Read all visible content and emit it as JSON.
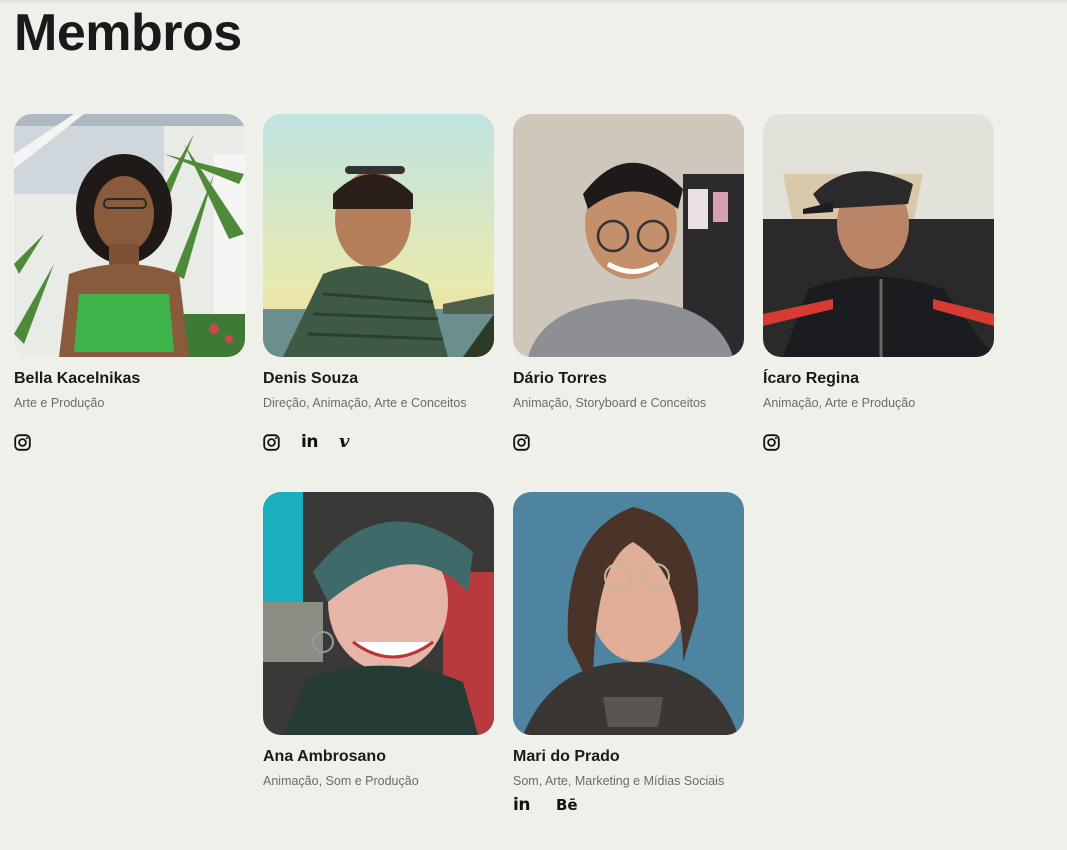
{
  "page": {
    "title": "Membros"
  },
  "members": [
    {
      "name": "Bella Kacelnikas",
      "role": "Arte e Produção",
      "socials": [
        "instagram"
      ],
      "photo_bg": "#b9c7b3"
    },
    {
      "name": "Denis Souza",
      "role": "Direção, Animação, Arte e Conceitos",
      "socials": [
        "instagram",
        "linkedin",
        "vimeo"
      ],
      "photo_bg": "#c5ddd0"
    },
    {
      "name": "Dário Torres",
      "role": "Animação, Storyboard e Conceitos",
      "socials": [
        "instagram"
      ],
      "photo_bg": "#c9c2b8"
    },
    {
      "name": "Ícaro Regina",
      "role": "Animação, Arte e Produção",
      "socials": [
        "instagram"
      ],
      "photo_bg": "#d9d8d0"
    },
    {
      "name": "Ana Ambrosano",
      "role": "Animação, Som e Produção",
      "socials": [],
      "photo_bg": "#3b6b6a"
    },
    {
      "name": "Mari do Prado",
      "role": "Som, Arte, Marketing e Mídias Sociais",
      "socials": [
        "linkedin",
        "behance"
      ],
      "photo_bg": "#4a7a95"
    }
  ],
  "social_labels": {
    "linkedin": "in",
    "behance": "Bē",
    "vimeo": "v"
  }
}
